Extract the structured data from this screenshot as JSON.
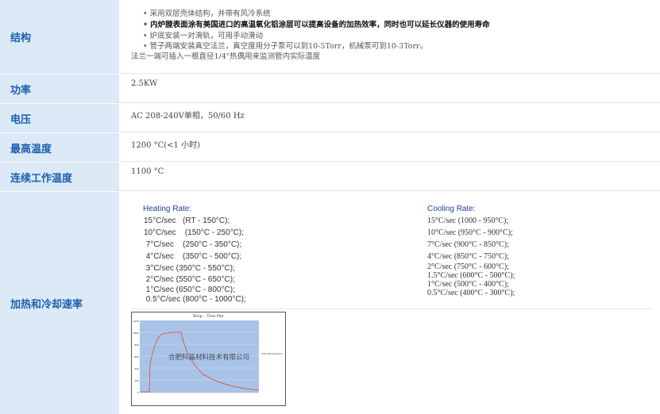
{
  "rows": {
    "structure": {
      "label": "结构",
      "bullets": [
        "采用双层壳体结构，并带有风冷系统",
        "内炉膛表面涂有美国进口的高温氧化铝涂层可以提高设备的加热效率，同时也可以延长仪器的使用寿命",
        "炉底安装一对滑轨，可用手动滑动",
        "管子两端安装真空法兰，真空度用分子泵可以到10-5Torr，机械泵可到10-3Torr。"
      ],
      "note": "法兰一端可插入一根直径1/4\"热偶用来监测管内实际温度"
    },
    "power": {
      "label": "功率",
      "value": "2.5KW"
    },
    "voltage": {
      "label": "电压",
      "value": "AC 208-240V单相，50/60 Hz"
    },
    "max_temp": {
      "label": "最高温度",
      "value": "1200 °C(<1 小时)"
    },
    "cont_temp": {
      "label": "连续工作温度",
      "value": "1100 °C"
    },
    "rates": {
      "label": "加热和冷却速率",
      "heating_title": "Heating Rate:",
      "heating": [
        "15°C/sec   (RT - 150°C);",
        "10°C/sec    (150°C - 250°C);",
        " 7°C/sec    (250°C - 350°C);",
        " 4°C/sec    (350°C - 500°C);",
        " 3°C/sec (350°C - 550°C);",
        " 2°C/sec (550°C - 650°C);",
        " 1°C/sec (650°C - 800°C);",
        " 0.5°C/sec (800°C - 1000°C);"
      ],
      "cooling_title": "Cooling Rate:",
      "cooling": [
        "15°C/sec (1000 - 950°C);",
        "10°C/sec (950°C - 900°C);",
        "7°C/sec (900°C - 850°C);",
        "4°C/sec (850°C - 750°C);",
        "2°C/sec (750°C - 600°C);",
        "1.5°C/sec (600°C - 500°C);",
        "1°C/sec (500°C - 400°C);",
        "0.5°C/sec (400°C - 300°C);"
      ]
    }
  },
  "plot": {
    "title": "Temp. - Time Plot",
    "watermark": "合肥科晶材料技术有限公司",
    "legend": "Temperature",
    "yticks": [
      "1200",
      "1000",
      "800",
      "600",
      "400",
      "200",
      "0"
    ],
    "colors": {
      "plot_bg": "#a9c3e8",
      "curve": "#e0443c",
      "label_bg": "#dce9f7",
      "label_text": "#1c5fae"
    }
  }
}
